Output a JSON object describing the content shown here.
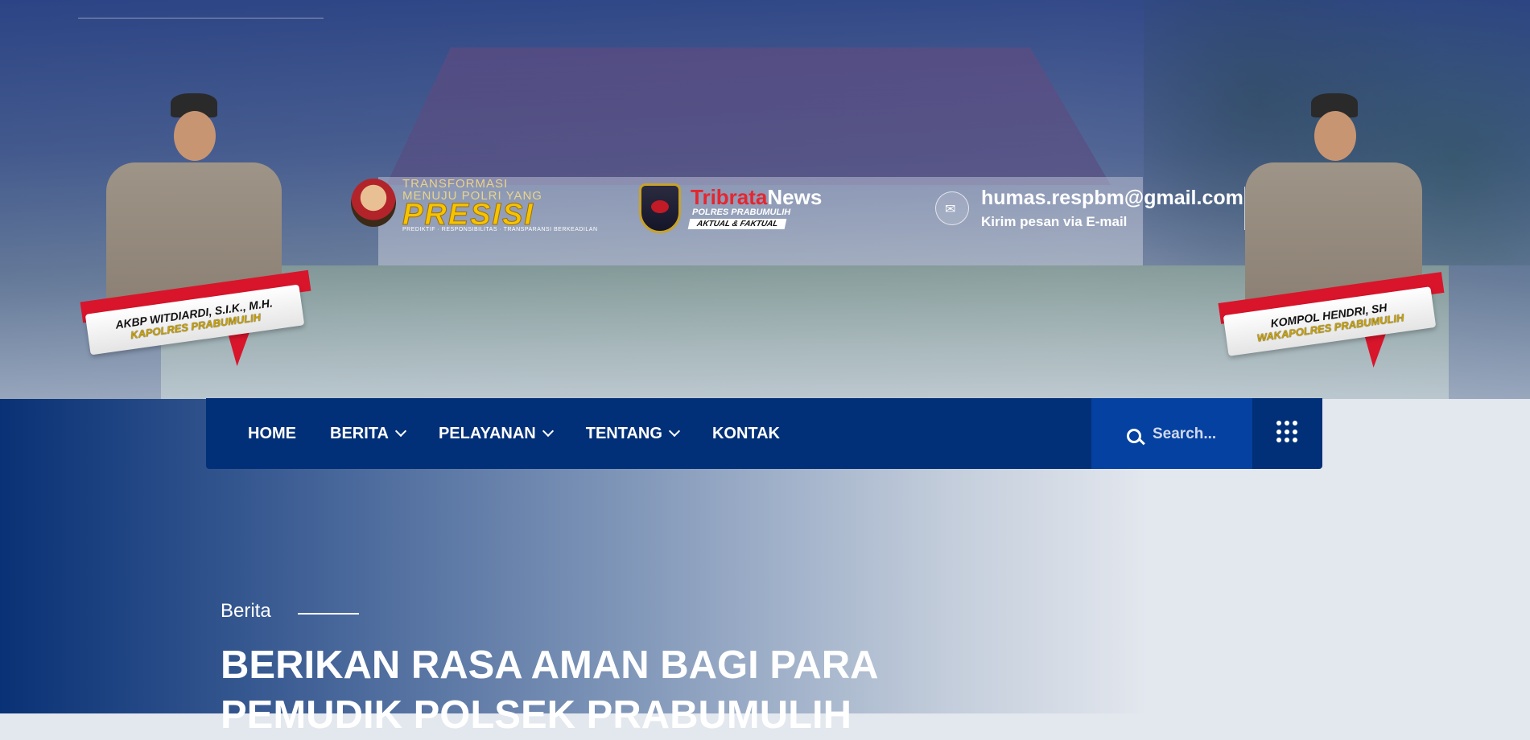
{
  "header": {
    "officer_left": {
      "name": "AKBP WITDIARDI, S.I.K., M.H.",
      "rank": "KAPOLRES PRABUMULIH"
    },
    "officer_right": {
      "name": "KOMPOL HENDRI, SH",
      "rank": "WAKAPOLRES PRABUMULIH"
    },
    "presisi": {
      "line1": "TRANSFORMASI",
      "line2": "MENUJU POLRI YANG",
      "word": "PRESISI",
      "tagline": "PREDIKTIF · RESPONSIBILITAS · TRANSPARANSI BERKEADILAN"
    },
    "tribrata": {
      "brand_red": "Tribrata",
      "brand_white": "News",
      "sub1": "POLRES PRABUMULIH",
      "sub2": "AKTUAL & FAKTUAL"
    },
    "contact": {
      "email": "humas.respbm@gmail.com",
      "subtitle": "Kirim pesan via E-mail",
      "icon": "envelope-open-icon"
    }
  },
  "nav": {
    "items": [
      {
        "label": "HOME",
        "has_dropdown": false
      },
      {
        "label": "BERITA",
        "has_dropdown": true
      },
      {
        "label": "PELAYANAN",
        "has_dropdown": true
      },
      {
        "label": "TENTANG",
        "has_dropdown": true
      },
      {
        "label": "KONTAK",
        "has_dropdown": false
      }
    ],
    "search_placeholder": "Search...",
    "search_icon": "search-icon",
    "menu_icon": "grid-dots-icon"
  },
  "hero": {
    "breadcrumb": "Berita",
    "headline": "BERIKAN RASA AMAN BAGI PARA PEMUDIK POLSEK PRABUMULIH"
  },
  "colors": {
    "nav_bg": "#023078",
    "search_bg": "#0541a0",
    "ribbon_red": "#d9152b",
    "rank_gold": "#c8a000"
  }
}
